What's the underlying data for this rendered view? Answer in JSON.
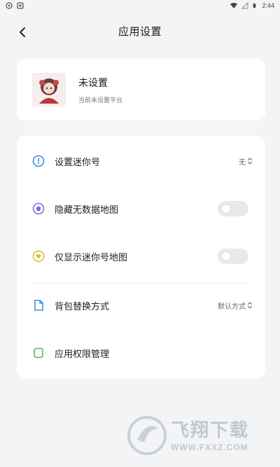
{
  "status_bar": {
    "time": "2:44",
    "left_icons": [
      "chat-icon",
      "app-icon"
    ],
    "right_icons": [
      "wifi-icon",
      "signal-icon",
      "battery-icon"
    ]
  },
  "header": {
    "title": "应用设置",
    "back_icon": "chevron-left-icon"
  },
  "profile": {
    "name": "未设置",
    "subtitle": "当前未设置平台"
  },
  "settings": {
    "items": [
      {
        "label": "设置迷你号",
        "value": "无",
        "icon": "pin-icon",
        "icon_color": "#3d8fe0",
        "control": "select"
      },
      {
        "label": "隐藏无数据地图",
        "icon": "shield-icon",
        "icon_color": "#7b6fd6",
        "control": "toggle",
        "on": false
      },
      {
        "label": "仅显示迷你号地图",
        "icon": "heart-icon",
        "icon_color": "#e5b83a",
        "control": "toggle",
        "on": false
      },
      {
        "label": "背包替换方式",
        "value": "默认方式",
        "icon": "document-icon",
        "icon_color": "#3d8fe0",
        "control": "select"
      },
      {
        "label": "应用权限管理",
        "icon": "square-icon",
        "icon_color": "#4cb86a",
        "control": "none"
      }
    ]
  },
  "watermark": {
    "title": "飞翔下载",
    "url": "WWW.FXXZ.COM"
  }
}
